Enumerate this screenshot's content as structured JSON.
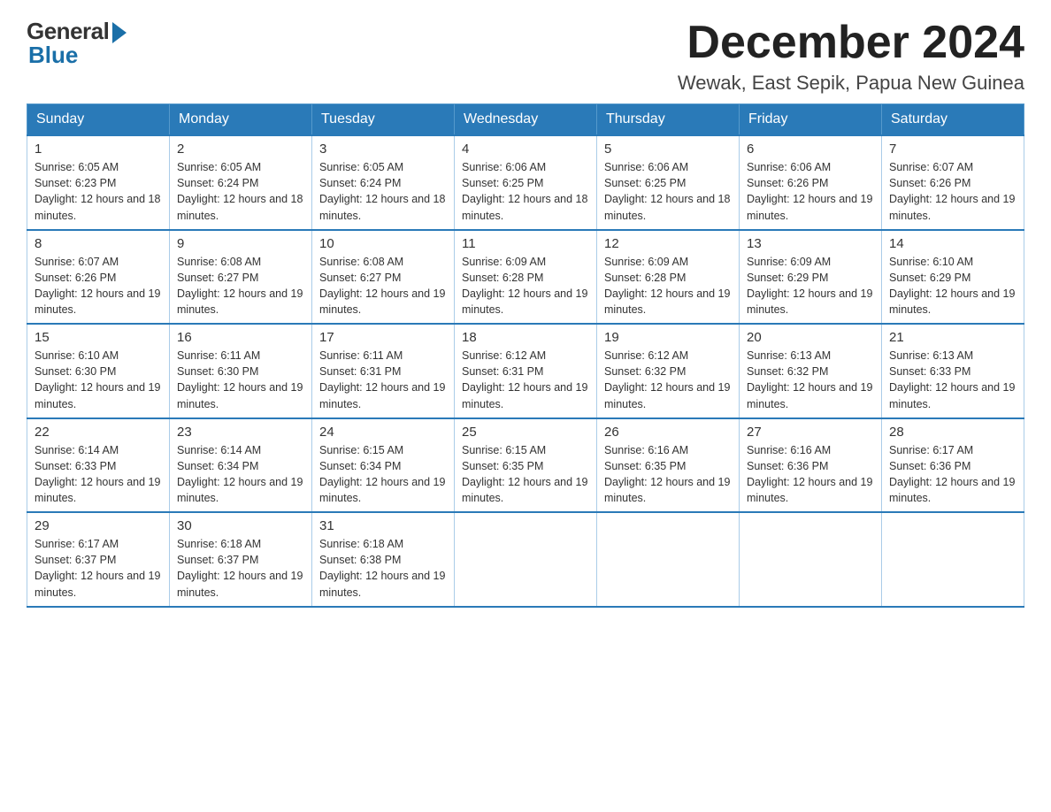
{
  "header": {
    "logo_general": "General",
    "logo_blue": "Blue",
    "month_title": "December 2024",
    "location": "Wewak, East Sepik, Papua New Guinea"
  },
  "weekdays": [
    "Sunday",
    "Monday",
    "Tuesday",
    "Wednesday",
    "Thursday",
    "Friday",
    "Saturday"
  ],
  "weeks": [
    [
      {
        "day": "1",
        "sunrise": "6:05 AM",
        "sunset": "6:23 PM",
        "daylight": "12 hours and 18 minutes."
      },
      {
        "day": "2",
        "sunrise": "6:05 AM",
        "sunset": "6:24 PM",
        "daylight": "12 hours and 18 minutes."
      },
      {
        "day": "3",
        "sunrise": "6:05 AM",
        "sunset": "6:24 PM",
        "daylight": "12 hours and 18 minutes."
      },
      {
        "day": "4",
        "sunrise": "6:06 AM",
        "sunset": "6:25 PM",
        "daylight": "12 hours and 18 minutes."
      },
      {
        "day": "5",
        "sunrise": "6:06 AM",
        "sunset": "6:25 PM",
        "daylight": "12 hours and 18 minutes."
      },
      {
        "day": "6",
        "sunrise": "6:06 AM",
        "sunset": "6:26 PM",
        "daylight": "12 hours and 19 minutes."
      },
      {
        "day": "7",
        "sunrise": "6:07 AM",
        "sunset": "6:26 PM",
        "daylight": "12 hours and 19 minutes."
      }
    ],
    [
      {
        "day": "8",
        "sunrise": "6:07 AM",
        "sunset": "6:26 PM",
        "daylight": "12 hours and 19 minutes."
      },
      {
        "day": "9",
        "sunrise": "6:08 AM",
        "sunset": "6:27 PM",
        "daylight": "12 hours and 19 minutes."
      },
      {
        "day": "10",
        "sunrise": "6:08 AM",
        "sunset": "6:27 PM",
        "daylight": "12 hours and 19 minutes."
      },
      {
        "day": "11",
        "sunrise": "6:09 AM",
        "sunset": "6:28 PM",
        "daylight": "12 hours and 19 minutes."
      },
      {
        "day": "12",
        "sunrise": "6:09 AM",
        "sunset": "6:28 PM",
        "daylight": "12 hours and 19 minutes."
      },
      {
        "day": "13",
        "sunrise": "6:09 AM",
        "sunset": "6:29 PM",
        "daylight": "12 hours and 19 minutes."
      },
      {
        "day": "14",
        "sunrise": "6:10 AM",
        "sunset": "6:29 PM",
        "daylight": "12 hours and 19 minutes."
      }
    ],
    [
      {
        "day": "15",
        "sunrise": "6:10 AM",
        "sunset": "6:30 PM",
        "daylight": "12 hours and 19 minutes."
      },
      {
        "day": "16",
        "sunrise": "6:11 AM",
        "sunset": "6:30 PM",
        "daylight": "12 hours and 19 minutes."
      },
      {
        "day": "17",
        "sunrise": "6:11 AM",
        "sunset": "6:31 PM",
        "daylight": "12 hours and 19 minutes."
      },
      {
        "day": "18",
        "sunrise": "6:12 AM",
        "sunset": "6:31 PM",
        "daylight": "12 hours and 19 minutes."
      },
      {
        "day": "19",
        "sunrise": "6:12 AM",
        "sunset": "6:32 PM",
        "daylight": "12 hours and 19 minutes."
      },
      {
        "day": "20",
        "sunrise": "6:13 AM",
        "sunset": "6:32 PM",
        "daylight": "12 hours and 19 minutes."
      },
      {
        "day": "21",
        "sunrise": "6:13 AM",
        "sunset": "6:33 PM",
        "daylight": "12 hours and 19 minutes."
      }
    ],
    [
      {
        "day": "22",
        "sunrise": "6:14 AM",
        "sunset": "6:33 PM",
        "daylight": "12 hours and 19 minutes."
      },
      {
        "day": "23",
        "sunrise": "6:14 AM",
        "sunset": "6:34 PM",
        "daylight": "12 hours and 19 minutes."
      },
      {
        "day": "24",
        "sunrise": "6:15 AM",
        "sunset": "6:34 PM",
        "daylight": "12 hours and 19 minutes."
      },
      {
        "day": "25",
        "sunrise": "6:15 AM",
        "sunset": "6:35 PM",
        "daylight": "12 hours and 19 minutes."
      },
      {
        "day": "26",
        "sunrise": "6:16 AM",
        "sunset": "6:35 PM",
        "daylight": "12 hours and 19 minutes."
      },
      {
        "day": "27",
        "sunrise": "6:16 AM",
        "sunset": "6:36 PM",
        "daylight": "12 hours and 19 minutes."
      },
      {
        "day": "28",
        "sunrise": "6:17 AM",
        "sunset": "6:36 PM",
        "daylight": "12 hours and 19 minutes."
      }
    ],
    [
      {
        "day": "29",
        "sunrise": "6:17 AM",
        "sunset": "6:37 PM",
        "daylight": "12 hours and 19 minutes."
      },
      {
        "day": "30",
        "sunrise": "6:18 AM",
        "sunset": "6:37 PM",
        "daylight": "12 hours and 19 minutes."
      },
      {
        "day": "31",
        "sunrise": "6:18 AM",
        "sunset": "6:38 PM",
        "daylight": "12 hours and 19 minutes."
      },
      null,
      null,
      null,
      null
    ]
  ]
}
